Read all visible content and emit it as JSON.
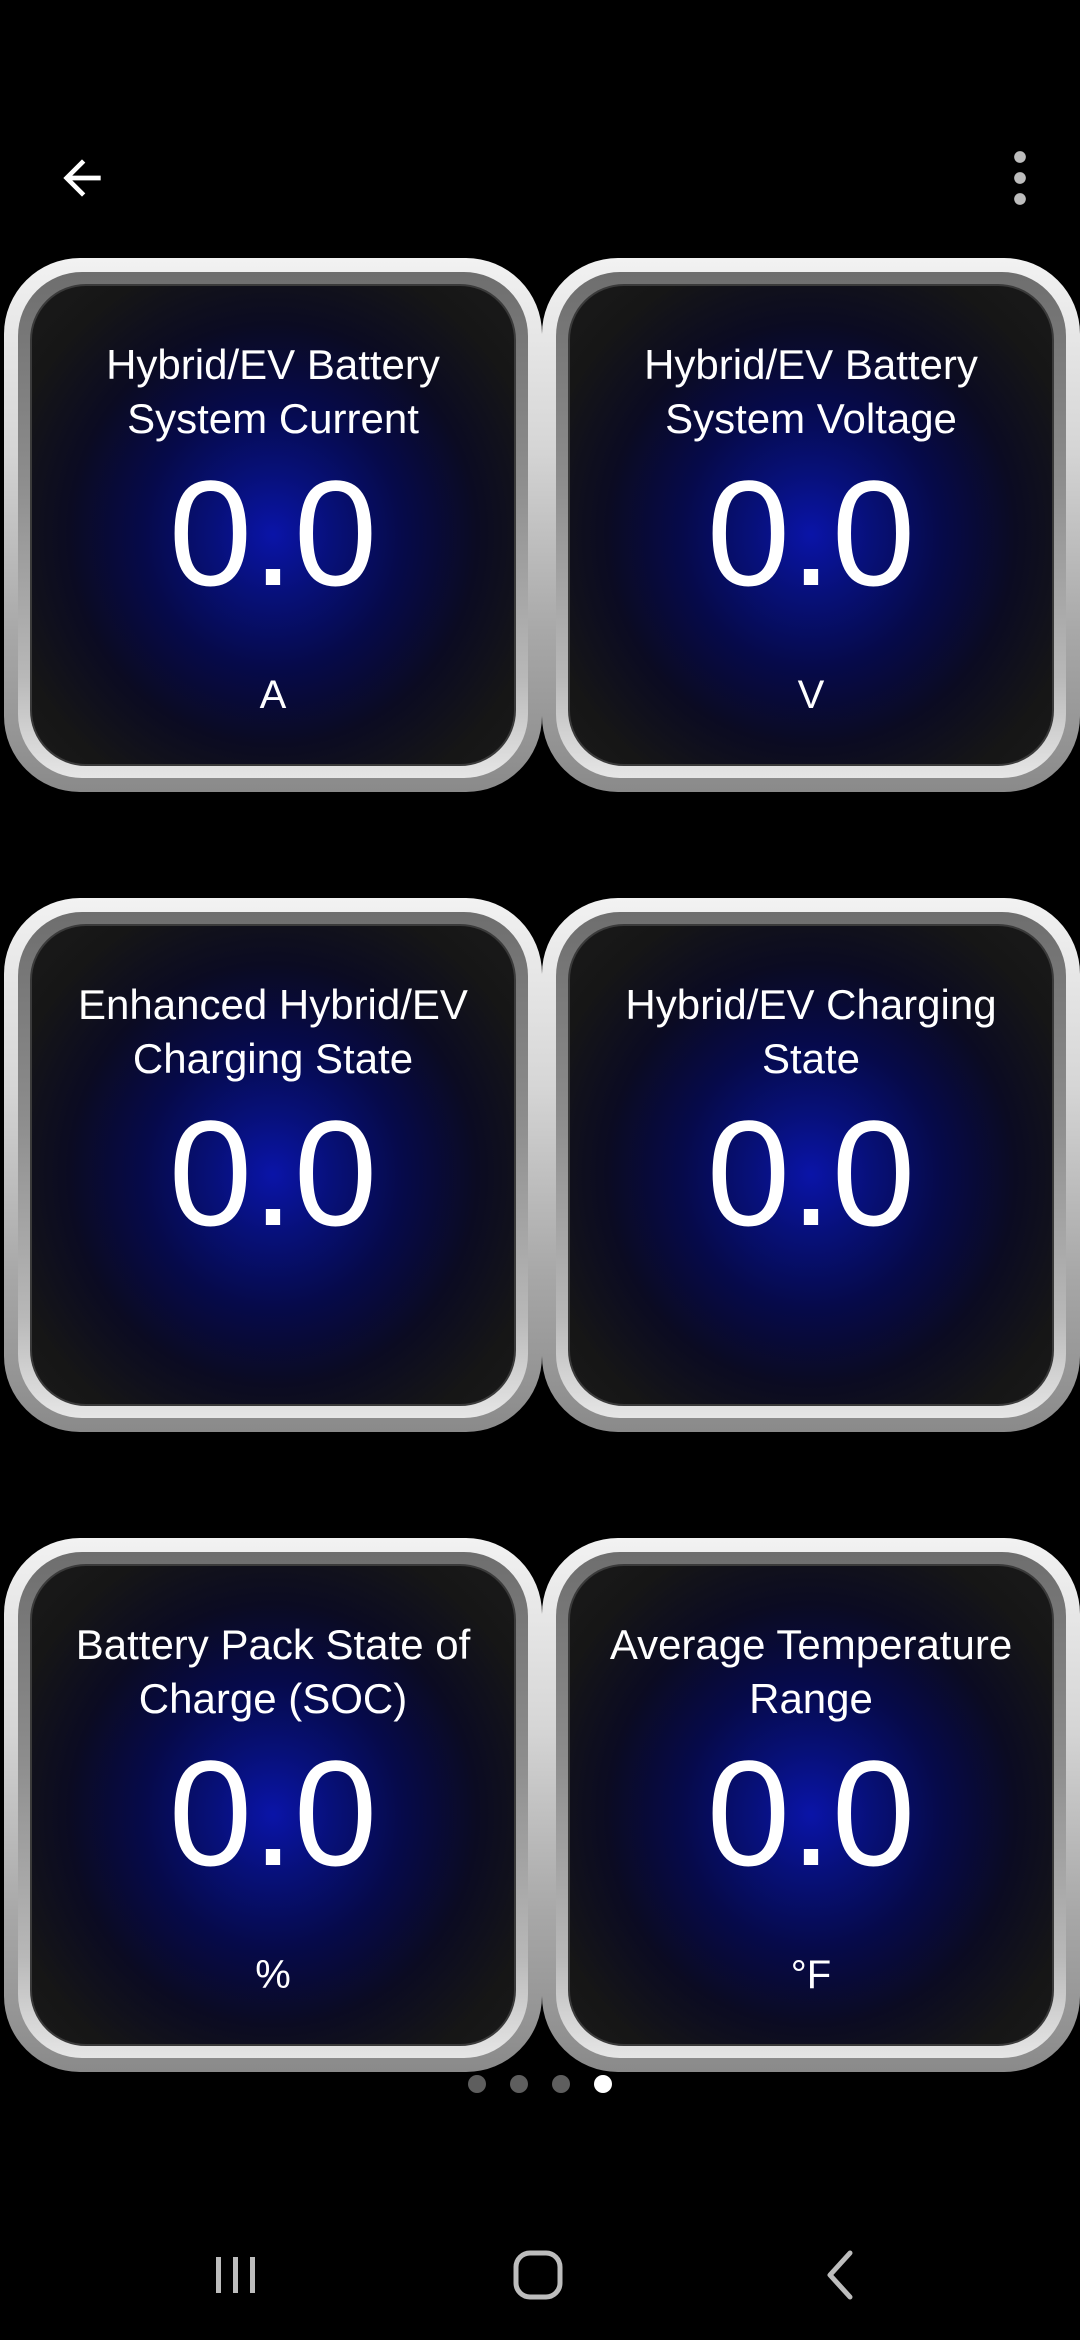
{
  "app": {
    "icons": {
      "back": "arrow-left-icon",
      "more": "more-vertical-icon"
    }
  },
  "gauges": [
    {
      "label": "Hybrid/EV Battery System Current",
      "value": "0.0",
      "unit": "A"
    },
    {
      "label": "Hybrid/EV Battery System Voltage",
      "value": "0.0",
      "unit": "V"
    },
    {
      "label": "Enhanced Hybrid/EV Charging State",
      "value": "0.0",
      "unit": ""
    },
    {
      "label": "Hybrid/EV Charging State",
      "value": "0.0",
      "unit": ""
    },
    {
      "label": "Battery Pack State of Charge (SOC)",
      "value": "0.0",
      "unit": "%"
    },
    {
      "label": "Average Temperature Range",
      "value": "0.0",
      "unit": "°F"
    }
  ],
  "pager": {
    "count": 4,
    "active_index": 3
  },
  "system_nav": {
    "recents_icon": "recents-icon",
    "home_icon": "home-icon",
    "back_icon": "nav-back-icon"
  },
  "colors": {
    "background": "#000000",
    "gauge_glow": "#0a14a8",
    "dot_inactive": "#5e5e5e",
    "dot_active": "#ffffff"
  }
}
